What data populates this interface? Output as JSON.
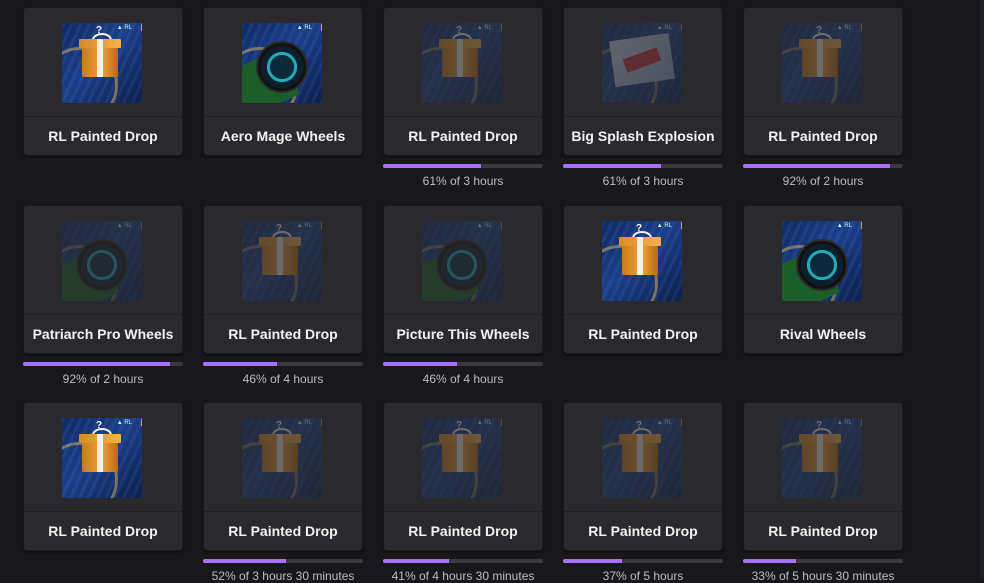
{
  "accent_color": "#a970ff",
  "rows": [
    [
      {
        "title": "RL Painted Drop",
        "icon": "gift-box-icon",
        "dim": false,
        "progress": null,
        "progress_text": ""
      },
      {
        "title": "Aero Mage Wheels",
        "icon": "wheel-icon",
        "dim": false,
        "progress": null,
        "progress_text": ""
      },
      {
        "title": "RL Painted Drop",
        "icon": "gift-box-icon",
        "dim": true,
        "progress": 0.61,
        "progress_text": "61% of 3 hours"
      },
      {
        "title": "Big Splash Explosion",
        "icon": "splash-decal-icon",
        "dim": true,
        "progress": 0.61,
        "progress_text": "61% of 3 hours"
      },
      {
        "title": "RL Painted Drop",
        "icon": "gift-box-icon",
        "dim": true,
        "progress": 0.92,
        "progress_text": "92% of 2 hours"
      }
    ],
    [
      {
        "title": "Patriarch Pro Wheels",
        "icon": "wheel-icon",
        "dim": true,
        "progress": 0.92,
        "progress_text": "92% of 2 hours"
      },
      {
        "title": "RL Painted Drop",
        "icon": "gift-box-icon",
        "dim": true,
        "progress": 0.46,
        "progress_text": "46% of 4 hours"
      },
      {
        "title": "Picture This Wheels",
        "icon": "wheel-icon",
        "dim": true,
        "progress": 0.46,
        "progress_text": "46% of 4 hours"
      },
      {
        "title": "RL Painted Drop",
        "icon": "gift-box-icon",
        "dim": false,
        "progress": null,
        "progress_text": ""
      },
      {
        "title": "Rival Wheels",
        "icon": "wheel-icon",
        "dim": false,
        "progress": null,
        "progress_text": ""
      }
    ],
    [
      {
        "title": "RL Painted Drop",
        "icon": "gift-box-icon",
        "dim": false,
        "progress": null,
        "progress_text": ""
      },
      {
        "title": "RL Painted Drop",
        "icon": "gift-box-icon",
        "dim": true,
        "progress": 0.52,
        "progress_text": "52% of 3 hours 30 minutes"
      },
      {
        "title": "RL Painted Drop",
        "icon": "gift-box-icon",
        "dim": true,
        "progress": 0.41,
        "progress_text": "41% of 4 hours 30 minutes"
      },
      {
        "title": "RL Painted Drop",
        "icon": "gift-box-icon",
        "dim": true,
        "progress": 0.37,
        "progress_text": "37% of 5 hours"
      },
      {
        "title": "RL Painted Drop",
        "icon": "gift-box-icon",
        "dim": true,
        "progress": 0.33,
        "progress_text": "33% of 5 hours 30 minutes"
      }
    ]
  ]
}
